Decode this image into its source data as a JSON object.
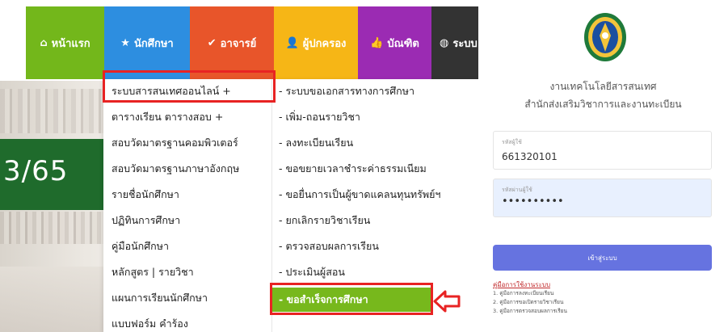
{
  "nav": {
    "items": [
      {
        "label": "หน้าแรก",
        "icon": "home-icon",
        "glyph": "⌂",
        "color": "#73b71b"
      },
      {
        "label": "นักศึกษา",
        "icon": "star-icon",
        "glyph": "★",
        "color": "#2d8ee0"
      },
      {
        "label": "อาจารย์",
        "icon": "check-icon",
        "glyph": "✔",
        "color": "#e8552a"
      },
      {
        "label": "ผู้ปกครอง",
        "icon": "user-icon",
        "glyph": "👤",
        "color": "#f6b616"
      },
      {
        "label": "บัณฑิต",
        "icon": "thumbs-up-icon",
        "glyph": "👍",
        "color": "#9b2bb3"
      },
      {
        "label": "ระบบ",
        "icon": "globe-icon",
        "glyph": "◍",
        "color": "#333333"
      }
    ]
  },
  "hero": {
    "text": "3/65"
  },
  "dropdown": {
    "left": [
      "ระบบสารสนเทศออนไลน์ +",
      "ตารางเรียน ตารางสอบ +",
      "สอบวัดมาตรฐานคอมพิวเตอร์",
      "สอบวัดมาตรฐานภาษาอังกฤษ",
      "รายชื่อนักศึกษา",
      "ปฏิทินการศึกษา",
      "คู่มือนักศึกษา",
      "หลักสูตร | รายวิชา",
      "แผนการเรียนนักศึกษา",
      "แบบฟอร์ม คำร้อง"
    ],
    "right": [
      "- ระบบขอเอกสารทางการศึกษา",
      "- เพิ่ม-ถอนรายวิชา",
      "- ลงทะเบียนเรียน",
      "- ขอขยายเวลาชำระค่าธรรมเนียม",
      "- ขอยื่นการเป็นผู้ขาดแคลนทุนทรัพย์ฯ",
      "- ยกเลิกรายวิชาเรียน",
      "- ตรวจสอบผลการเรียน",
      "- ประเมินผู้สอน",
      "- ขอสำเร็จการศึกษา"
    ],
    "highlight_color": "#77b81c"
  },
  "login": {
    "org_line1": "งานเทคโนโลยีสารสนเทศ",
    "org_line2": "สำนักส่งเสริมวิชาการและงานทะเบียน",
    "username_label": "รหัสผู้ใช้",
    "username_value": "661320101",
    "password_label": "รหัสผ่านผู้ใช้",
    "password_value": "••••••••••",
    "login_button": "เข้าสู่ระบบ",
    "guide_title": "คู่มือการใช้งานระบบ",
    "guides": [
      "1. คู่มือการลงทะเบียนเรียน",
      "2. คู่มือการขอเปิดรายวิชาเรียน",
      "3. คู่มือการตรวจสอบผลการเรียน"
    ],
    "button_color": "#6673e0"
  },
  "annotation_color": "#e82323"
}
